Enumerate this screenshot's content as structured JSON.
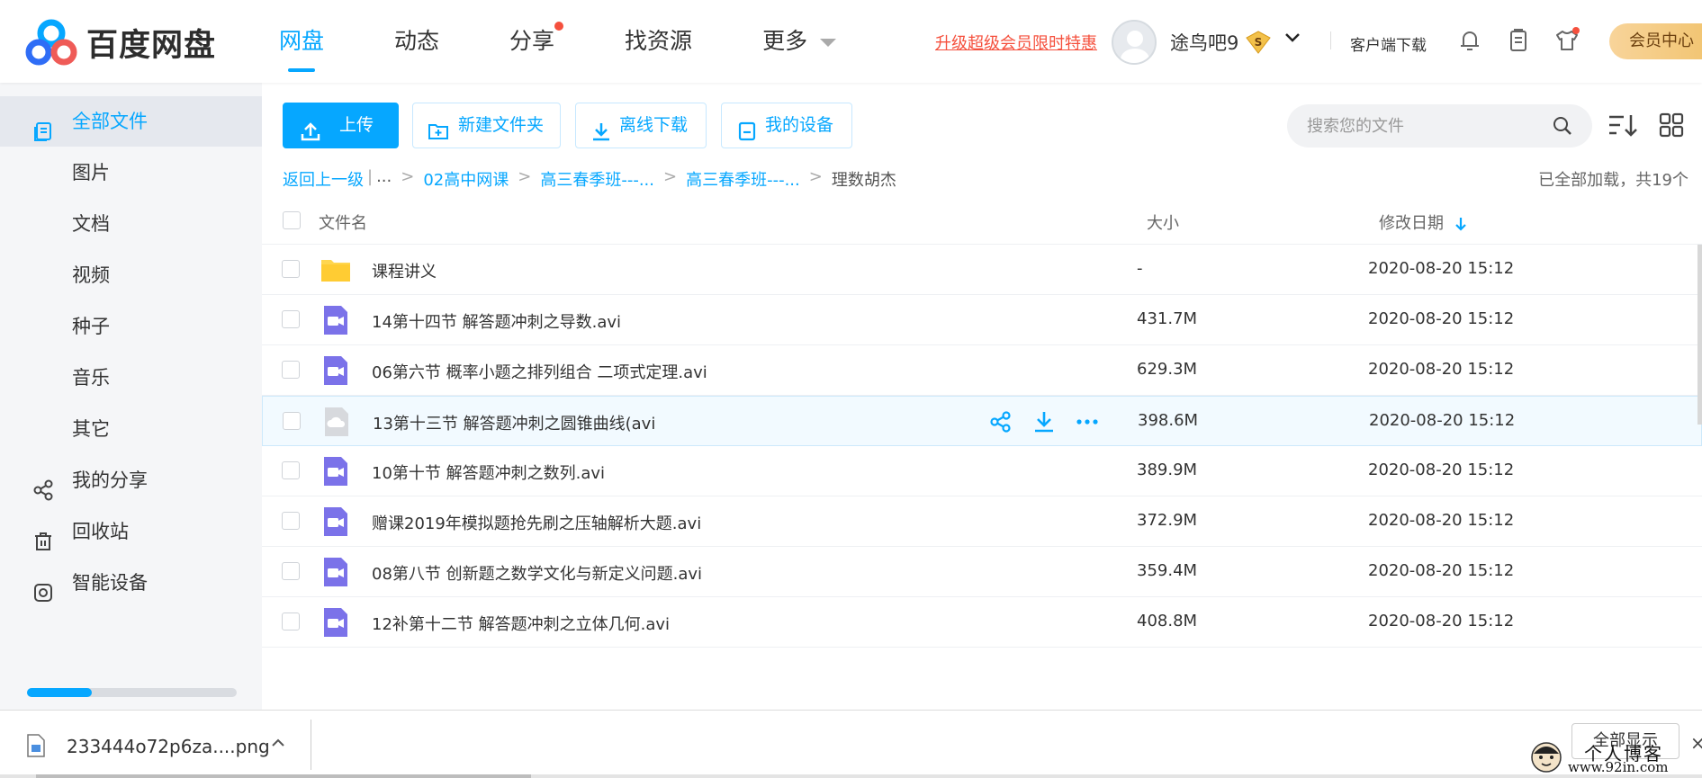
{
  "app": {
    "logo_text": "百度网盘"
  },
  "topnav": {
    "items": [
      "网盘",
      "动态",
      "分享",
      "找资源",
      "更多"
    ],
    "active": "网盘"
  },
  "header": {
    "promo": "升级超级会员限时特惠",
    "username": "途鸟吧9",
    "vip_letter": "S",
    "client_download": "客户端下载",
    "member_center": "会员中心"
  },
  "sidebar": {
    "items": [
      "全部文件",
      "图片",
      "文档",
      "视频",
      "种子",
      "音乐",
      "其它",
      "我的分享",
      "回收站",
      "智能设备"
    ],
    "quota_used_fraction": 0.31
  },
  "toolbar": {
    "upload": "上传",
    "new_folder": "新建文件夹",
    "offline_download": "离线下载",
    "my_devices": "我的设备",
    "search_placeholder": "搜索您的文件"
  },
  "breadcrumb": {
    "back": "返回上一级",
    "sep": "|",
    "ellipsis": "...",
    "gt": ">",
    "items": [
      "02高中网课",
      "高三春季班---...",
      "高三春季班---..."
    ],
    "current": "理数胡杰",
    "loaded_status": "已全部加载，共19个"
  },
  "table": {
    "headers": {
      "name": "文件名",
      "size": "大小",
      "date": "修改日期"
    },
    "rows": [
      {
        "name": "课程讲义",
        "size": "-",
        "date": "2020-08-20 15:12",
        "type": "folder"
      },
      {
        "name": "14第十四节 解答题冲刺之导数.avi",
        "size": "431.7M",
        "date": "2020-08-20 15:12",
        "type": "video"
      },
      {
        "name": "06第六节 概率小题之排列组合 二项式定理.avi",
        "size": "629.3M",
        "date": "2020-08-20 15:12",
        "type": "video"
      },
      {
        "name": "13第十三节 解答题冲刺之圆锥曲线(avi",
        "size": "398.6M",
        "date": "2020-08-20 15:12",
        "type": "cloud"
      },
      {
        "name": "10第十节 解答题冲刺之数列.avi",
        "size": "389.9M",
        "date": "2020-08-20 15:12",
        "type": "video"
      },
      {
        "name": "赠课2019年模拟题抢先刷之压轴解析大题.avi",
        "size": "372.9M",
        "date": "2020-08-20 15:12",
        "type": "video"
      },
      {
        "name": "08第八节 创新题之数学文化与新定义问题.avi",
        "size": "359.4M",
        "date": "2020-08-20 15:12",
        "type": "video"
      },
      {
        "name": "12补第十二节 解答题冲刺之立体几何.avi",
        "size": "408.8M",
        "date": "2020-08-20 15:12",
        "type": "video"
      }
    ]
  },
  "downloads": {
    "filename": "233444o72p6za....png",
    "show_all": "全部显示",
    "close": "×"
  },
  "watermark": {
    "line1": "个人博客",
    "line2": "www.92in.com"
  },
  "colors": {
    "accent": "#06a7ff",
    "promo": "#f5503d",
    "video_icon": "#7b72e9",
    "folder": "#ffd64f"
  }
}
